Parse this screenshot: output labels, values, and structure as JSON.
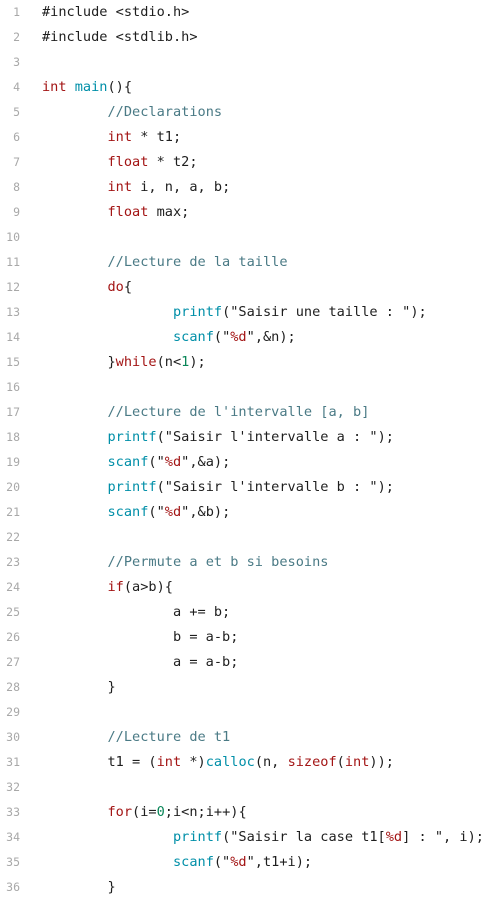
{
  "colors": {
    "background": "#ffffff",
    "line_number": "#a8a8a8",
    "plain": "#1e1e1e",
    "keyword": "#a31515",
    "function": "#008fa8",
    "string": "#a31515",
    "comment": "#4a7a85",
    "number": "#098658"
  },
  "lines": [
    {
      "n": "1",
      "tokens": [
        {
          "t": "#include <stdio.h>",
          "c": "p"
        }
      ]
    },
    {
      "n": "2",
      "tokens": [
        {
          "t": "#include <stdlib.h>",
          "c": "p"
        }
      ]
    },
    {
      "n": "3",
      "tokens": []
    },
    {
      "n": "4",
      "tokens": [
        {
          "t": "int",
          "c": "k"
        },
        {
          "t": " ",
          "c": "p"
        },
        {
          "t": "main",
          "c": "f"
        },
        {
          "t": "(){",
          "c": "p"
        }
      ]
    },
    {
      "n": "5",
      "tokens": [
        {
          "t": "        ",
          "c": "p"
        },
        {
          "t": "//Declarations",
          "c": "c"
        }
      ]
    },
    {
      "n": "6",
      "tokens": [
        {
          "t": "        ",
          "c": "p"
        },
        {
          "t": "int",
          "c": "k"
        },
        {
          "t": " * t1;",
          "c": "p"
        }
      ]
    },
    {
      "n": "7",
      "tokens": [
        {
          "t": "        ",
          "c": "p"
        },
        {
          "t": "float",
          "c": "k"
        },
        {
          "t": " * t2;",
          "c": "p"
        }
      ]
    },
    {
      "n": "8",
      "tokens": [
        {
          "t": "        ",
          "c": "p"
        },
        {
          "t": "int",
          "c": "k"
        },
        {
          "t": " i, n, a, b;",
          "c": "p"
        }
      ]
    },
    {
      "n": "9",
      "tokens": [
        {
          "t": "        ",
          "c": "p"
        },
        {
          "t": "float",
          "c": "k"
        },
        {
          "t": " max;",
          "c": "p"
        }
      ]
    },
    {
      "n": "10",
      "tokens": []
    },
    {
      "n": "11",
      "tokens": [
        {
          "t": "        ",
          "c": "p"
        },
        {
          "t": "//Lecture de la taille",
          "c": "c"
        }
      ]
    },
    {
      "n": "12",
      "tokens": [
        {
          "t": "        ",
          "c": "p"
        },
        {
          "t": "do",
          "c": "k"
        },
        {
          "t": "{",
          "c": "p"
        }
      ]
    },
    {
      "n": "13",
      "tokens": [
        {
          "t": "                ",
          "c": "p"
        },
        {
          "t": "printf",
          "c": "f"
        },
        {
          "t": "(",
          "c": "p"
        },
        {
          "t": "\"Saisir une taille : \"",
          "c": "p"
        },
        {
          "t": ");",
          "c": "p"
        }
      ]
    },
    {
      "n": "14",
      "tokens": [
        {
          "t": "                ",
          "c": "p"
        },
        {
          "t": "scanf",
          "c": "f"
        },
        {
          "t": "(",
          "c": "p"
        },
        {
          "t": "\"",
          "c": "p"
        },
        {
          "t": "%d",
          "c": "s"
        },
        {
          "t": "\"",
          "c": "p"
        },
        {
          "t": ",&n);",
          "c": "p"
        }
      ]
    },
    {
      "n": "15",
      "tokens": [
        {
          "t": "        }",
          "c": "p"
        },
        {
          "t": "while",
          "c": "k"
        },
        {
          "t": "(n<",
          "c": "p"
        },
        {
          "t": "1",
          "c": "n"
        },
        {
          "t": ");",
          "c": "p"
        }
      ]
    },
    {
      "n": "16",
      "tokens": []
    },
    {
      "n": "17",
      "tokens": [
        {
          "t": "        ",
          "c": "p"
        },
        {
          "t": "//Lecture de l'intervalle [a, b]",
          "c": "c"
        }
      ]
    },
    {
      "n": "18",
      "tokens": [
        {
          "t": "        ",
          "c": "p"
        },
        {
          "t": "printf",
          "c": "f"
        },
        {
          "t": "(\"Saisir l'intervalle a : \");",
          "c": "p"
        }
      ]
    },
    {
      "n": "19",
      "tokens": [
        {
          "t": "        ",
          "c": "p"
        },
        {
          "t": "scanf",
          "c": "f"
        },
        {
          "t": "(\"",
          "c": "p"
        },
        {
          "t": "%d",
          "c": "s"
        },
        {
          "t": "\",&a);",
          "c": "p"
        }
      ]
    },
    {
      "n": "20",
      "tokens": [
        {
          "t": "        ",
          "c": "p"
        },
        {
          "t": "printf",
          "c": "f"
        },
        {
          "t": "(\"Saisir l'intervalle b : \");",
          "c": "p"
        }
      ]
    },
    {
      "n": "21",
      "tokens": [
        {
          "t": "        ",
          "c": "p"
        },
        {
          "t": "scanf",
          "c": "f"
        },
        {
          "t": "(\"",
          "c": "p"
        },
        {
          "t": "%d",
          "c": "s"
        },
        {
          "t": "\",&b);",
          "c": "p"
        }
      ]
    },
    {
      "n": "22",
      "tokens": []
    },
    {
      "n": "23",
      "tokens": [
        {
          "t": "        ",
          "c": "p"
        },
        {
          "t": "//Permute a et b si besoins",
          "c": "c"
        }
      ]
    },
    {
      "n": "24",
      "tokens": [
        {
          "t": "        ",
          "c": "p"
        },
        {
          "t": "if",
          "c": "k"
        },
        {
          "t": "(a>b){",
          "c": "p"
        }
      ]
    },
    {
      "n": "25",
      "tokens": [
        {
          "t": "                a += b;",
          "c": "p"
        }
      ]
    },
    {
      "n": "26",
      "tokens": [
        {
          "t": "                b = a-b;",
          "c": "p"
        }
      ]
    },
    {
      "n": "27",
      "tokens": [
        {
          "t": "                a = a-b;",
          "c": "p"
        }
      ]
    },
    {
      "n": "28",
      "tokens": [
        {
          "t": "        }",
          "c": "p"
        }
      ]
    },
    {
      "n": "29",
      "tokens": []
    },
    {
      "n": "30",
      "tokens": [
        {
          "t": "        ",
          "c": "p"
        },
        {
          "t": "//Lecture de t1",
          "c": "c"
        }
      ]
    },
    {
      "n": "31",
      "tokens": [
        {
          "t": "        t1 = (",
          "c": "p"
        },
        {
          "t": "int",
          "c": "k"
        },
        {
          "t": " *)",
          "c": "p"
        },
        {
          "t": "calloc",
          "c": "f"
        },
        {
          "t": "(n, ",
          "c": "p"
        },
        {
          "t": "sizeof",
          "c": "k"
        },
        {
          "t": "(",
          "c": "p"
        },
        {
          "t": "int",
          "c": "k"
        },
        {
          "t": "));",
          "c": "p"
        }
      ]
    },
    {
      "n": "32",
      "tokens": []
    },
    {
      "n": "33",
      "tokens": [
        {
          "t": "        ",
          "c": "p"
        },
        {
          "t": "for",
          "c": "k"
        },
        {
          "t": "(i=",
          "c": "p"
        },
        {
          "t": "0",
          "c": "n"
        },
        {
          "t": ";i<n;i++){",
          "c": "p"
        }
      ]
    },
    {
      "n": "34",
      "tokens": [
        {
          "t": "                ",
          "c": "p"
        },
        {
          "t": "printf",
          "c": "f"
        },
        {
          "t": "(\"Saisir la case t1[",
          "c": "p"
        },
        {
          "t": "%d",
          "c": "s"
        },
        {
          "t": "] : \", i);",
          "c": "p"
        }
      ]
    },
    {
      "n": "35",
      "tokens": [
        {
          "t": "                ",
          "c": "p"
        },
        {
          "t": "scanf",
          "c": "f"
        },
        {
          "t": "(\"",
          "c": "p"
        },
        {
          "t": "%d",
          "c": "s"
        },
        {
          "t": "\",t1+i);",
          "c": "p"
        }
      ]
    },
    {
      "n": "36",
      "tokens": [
        {
          "t": "        }",
          "c": "p"
        }
      ]
    }
  ]
}
